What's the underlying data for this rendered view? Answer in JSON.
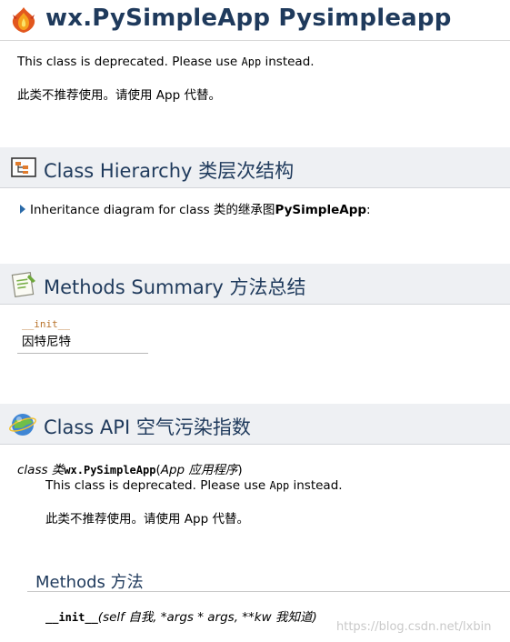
{
  "header": {
    "title": "wx.PySimpleApp Pysimpleapp",
    "icon": "phoenix-logo-icon"
  },
  "intro": {
    "deprecated_prefix": "This class is deprecated. Please use ",
    "deprecated_code": "App",
    "deprecated_suffix": " instead.",
    "chinese_note": "此类不推荐使用。请使用 App 代替。"
  },
  "hierarchy": {
    "section_title": "Class Hierarchy 类层次结构",
    "icon": "class-hierarchy-icon",
    "inheritance_prefix": "Inheritance diagram for class 类的继承图",
    "inheritance_class": "PySimpleApp",
    "inheritance_suffix": ":"
  },
  "methods_summary": {
    "section_title": "Methods Summary 方法总结",
    "icon": "notepad-icon",
    "rows": [
      {
        "method": "__init__",
        "description": "因特尼特"
      }
    ]
  },
  "class_api": {
    "section_title": "Class API 空气污染指数",
    "icon": "globe-icon",
    "signature_class_kw": "class 类",
    "signature_name": "wx.PySimpleApp",
    "signature_open": "(",
    "signature_param": "App 应用程序",
    "signature_close": ")",
    "deprecated_prefix": "This class is deprecated. Please use ",
    "deprecated_code": "App",
    "deprecated_suffix": " instead.",
    "chinese_note": "此类不推荐使用。请使用 App 代替。",
    "methods_subtitle": "Methods 方法",
    "init_name": "__init__",
    "init_params": "(self 自我, *args * args, **kw 我知道)"
  },
  "watermark": "https://blog.csdn.net/lxbin"
}
